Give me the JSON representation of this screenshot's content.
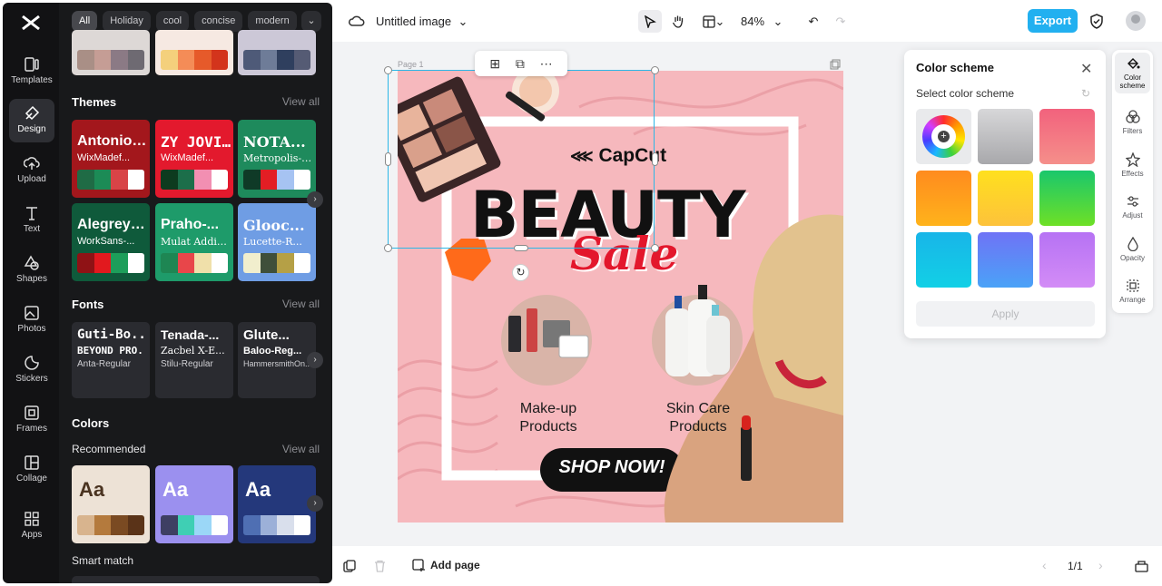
{
  "sidebar": {
    "items": [
      {
        "label": "Templates"
      },
      {
        "label": "Design"
      },
      {
        "label": "Upload"
      },
      {
        "label": "Text"
      },
      {
        "label": "Shapes"
      },
      {
        "label": "Photos"
      },
      {
        "label": "Stickers"
      },
      {
        "label": "Frames"
      },
      {
        "label": "Collage"
      },
      {
        "label": "Apps"
      }
    ]
  },
  "panel": {
    "chips": [
      "All",
      "Holiday",
      "cool",
      "concise",
      "modern"
    ],
    "themes_title": "Themes",
    "themes_view_all": "View all",
    "themes": [
      {
        "title": "Antonio-Bold",
        "sub": "WixMadef...",
        "bg": "#a3171c",
        "fg": "#ffffff",
        "swatches": [
          "#1f6b45",
          "#1c8b56",
          "#d84447",
          "#ffffff"
        ]
      },
      {
        "title": "ZY JOVI...",
        "sub": "WixMadef...",
        "bg": "#e3192d",
        "fg": "#ffffff",
        "swatches": [
          "#0d3b1f",
          "#1c6e4a",
          "#f28fb2",
          "#ffffff"
        ]
      },
      {
        "title": "NOTA...",
        "sub": "Metropolis-B...",
        "bg": "#1e8a5c",
        "fg": "#ffffff",
        "swatches": [
          "#0f3a27",
          "#e31e24",
          "#a6c3f2",
          "#ffffff"
        ]
      },
      {
        "title": "AlegreyaS...",
        "sub": "WorkSans-...",
        "bg": "#0f5a3b",
        "fg": "#ffffff",
        "swatches": [
          "#8f1215",
          "#e2191e",
          "#1d9e5a",
          "#ffffff"
        ]
      },
      {
        "title": "Praho-...",
        "sub": "Mulat Addis-...",
        "bg": "#1e9b6a",
        "fg": "#ffffff",
        "swatches": [
          "#1e8653",
          "#e8464a",
          "#f0e0aa",
          "#ffffff"
        ]
      },
      {
        "title": "Glooc...",
        "sub": "Lucette-R...",
        "bg": "#6f9de4",
        "fg": "#ffffff",
        "swatches": [
          "#f1eecd",
          "#3f4f3a",
          "#b5a046",
          "#ffffff"
        ]
      }
    ],
    "fonts_title": "Fonts",
    "fonts_view_all": "View all",
    "fonts": [
      {
        "f1": "Guti-Bo...",
        "f2": "BEYOND PRO...",
        "f3": "Anta-Regular"
      },
      {
        "f1": "Tenada-...",
        "f2": "Zacbel X-E...",
        "f3": "Stilu-Regular"
      },
      {
        "f1": "Glute...",
        "f2": "Baloo-Reg...",
        "f3": "HammersmithOn..."
      }
    ],
    "colors_title": "Colors",
    "recommended_label": "Recommended",
    "recommended_view_all": "View all",
    "color_cards": [
      {
        "label": "Aa",
        "bg": "#ede2d6",
        "fg": "#4a3320",
        "swatches": [
          "#d8b48e",
          "#b47a3d",
          "#7a4a22",
          "#5a3318"
        ]
      },
      {
        "label": "Aa",
        "bg": "#9b90ef",
        "fg": "#ffffff",
        "swatches": [
          "#3e3f63",
          "#3fcfb4",
          "#9bd7f7",
          "#ffffff"
        ]
      },
      {
        "label": "Aa",
        "bg": "#24387b",
        "fg": "#ffffff",
        "swatches": [
          "#4f6fb3",
          "#9cb0d8",
          "#d9dfec",
          "#ffffff"
        ]
      }
    ],
    "smart_match_label": "Smart match"
  },
  "topbar": {
    "doc_title": "Untitled image",
    "zoom": "84%",
    "export_label": "Export"
  },
  "canvas": {
    "page_label": "Page 1",
    "brand": "CapCut",
    "headline": "BEAUTY",
    "script": "Sale",
    "product1": "Make-up\nProducts",
    "product2": "Skin Care\nProducts",
    "cta": "SHOP NOW!"
  },
  "color_scheme": {
    "title": "Color scheme",
    "subtitle": "Select color scheme",
    "apply_label": "Apply"
  },
  "right_rail": {
    "items": [
      {
        "label": "Color scheme"
      },
      {
        "label": "Filters"
      },
      {
        "label": "Effects"
      },
      {
        "label": "Adjust"
      },
      {
        "label": "Opacity"
      },
      {
        "label": "Arrange"
      }
    ]
  },
  "bottombar": {
    "add_page_label": "Add page",
    "page_count": "1/1"
  }
}
